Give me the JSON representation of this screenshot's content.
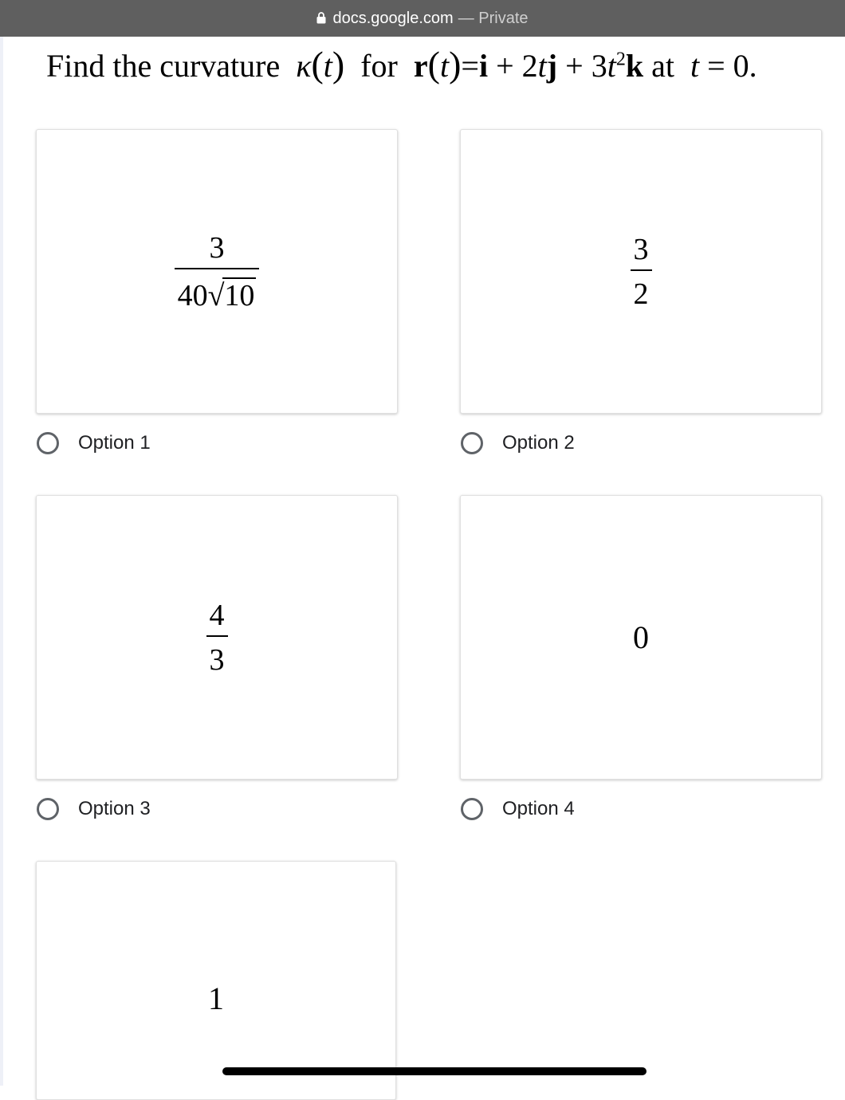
{
  "browser": {
    "domain": "docs.google.com",
    "separator": "—",
    "privacy_label": "Private",
    "icon": "lock-icon"
  },
  "question": {
    "prefix": "Find the curvature",
    "kappa": "κ",
    "t": "t",
    "for": "for",
    "r": "r",
    "eq": "=",
    "i": "i",
    "plus1": "+",
    "two": "2",
    "j": "j",
    "plus2": "+",
    "three": "3",
    "sq": "2",
    "k": "k",
    "at": "at",
    "zero": "0",
    "period": "."
  },
  "options": [
    {
      "label": "Option 1",
      "numerator": "3",
      "den_coeff": "40",
      "den_radicand": "10",
      "selected": false
    },
    {
      "label": "Option 2",
      "numerator": "3",
      "denominator": "2",
      "selected": false
    },
    {
      "label": "Option 3",
      "numerator": "4",
      "denominator": "3",
      "selected": false
    },
    {
      "label": "Option 4",
      "value": "0",
      "selected": false
    },
    {
      "value": "1"
    }
  ],
  "colors": {
    "url_bar": "#5f5f5f",
    "radio_border": "#5f6368",
    "text": "#202124"
  }
}
